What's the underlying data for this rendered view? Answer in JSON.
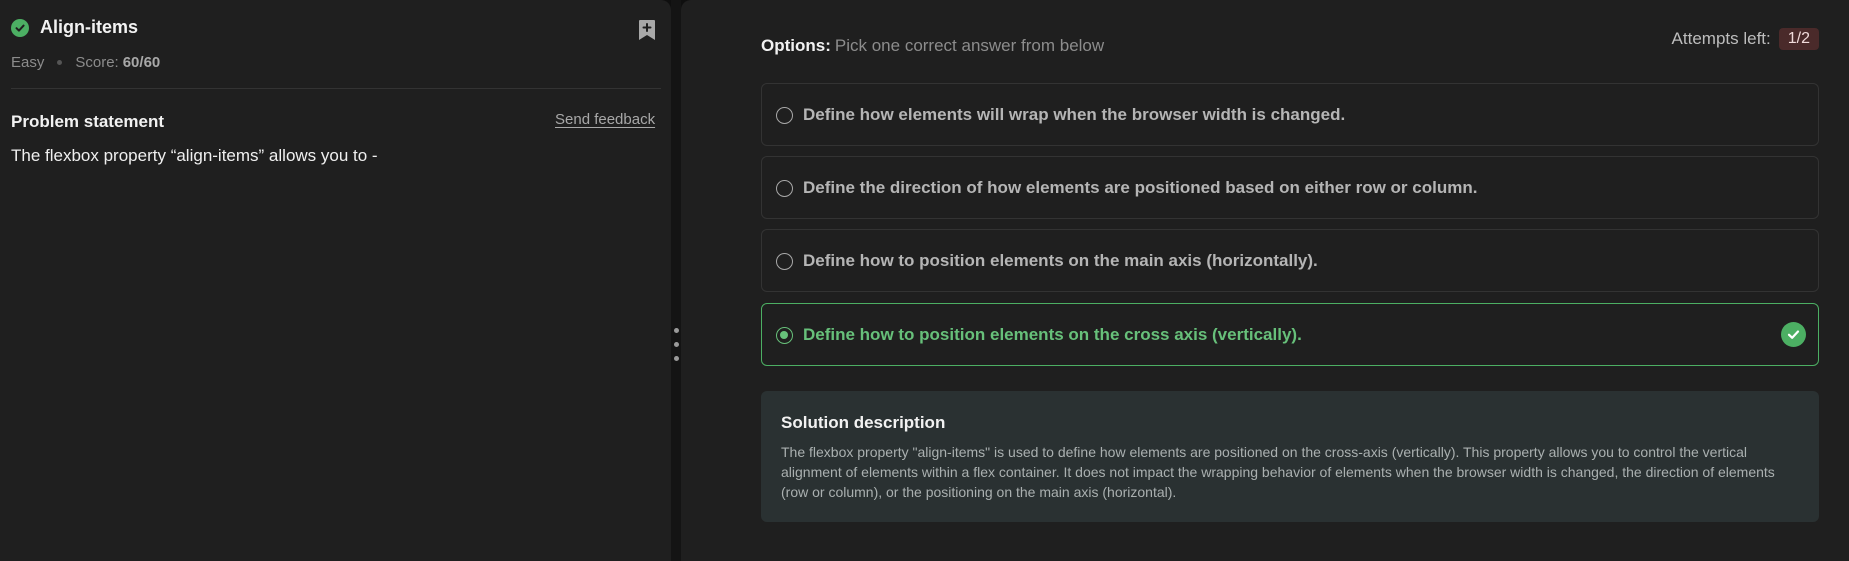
{
  "problem": {
    "title": "Align-items",
    "difficulty": "Easy",
    "score_label": "Score:",
    "score_value": "60/60"
  },
  "statement": {
    "heading": "Problem statement",
    "feedback_label": "Send feedback",
    "text": "The flexbox property “align-items” allows you to -"
  },
  "options_section": {
    "label": "Options:",
    "hint": "Pick one correct answer from below",
    "attempts_label": "Attempts left:",
    "attempts_value": "1/2",
    "items": [
      {
        "text": "Define how elements will wrap when the browser width is changed.",
        "selected": false
      },
      {
        "text": "Define the direction of how elements are positioned based on either row or column.",
        "selected": false
      },
      {
        "text": "Define how to position elements on the main axis (horizontally).",
        "selected": false
      },
      {
        "text": "Define how to position elements on the cross axis (vertically).",
        "selected": true
      }
    ]
  },
  "solution": {
    "title": "Solution description",
    "text": "The flexbox property \"align-items\" is used to define how elements are positioned on the cross-axis (vertically). This property allows you to control the vertical alignment of elements within a flex container. It does not impact the wrapping behavior of elements when the browser width is changed, the direction of elements (row or column), or the positioning on the main axis (horizontal)."
  },
  "colors": {
    "success": "#4caf63",
    "panel_bg": "#1f1f1f",
    "solution_bg": "#2a3132",
    "attempts_badge_bg": "#4a2a2a"
  },
  "icons": {
    "title_status": "check-circle-icon",
    "bookmark": "bookmark-plus-icon",
    "splitter": "drag-handle-icon",
    "correct": "check-circle-icon"
  }
}
